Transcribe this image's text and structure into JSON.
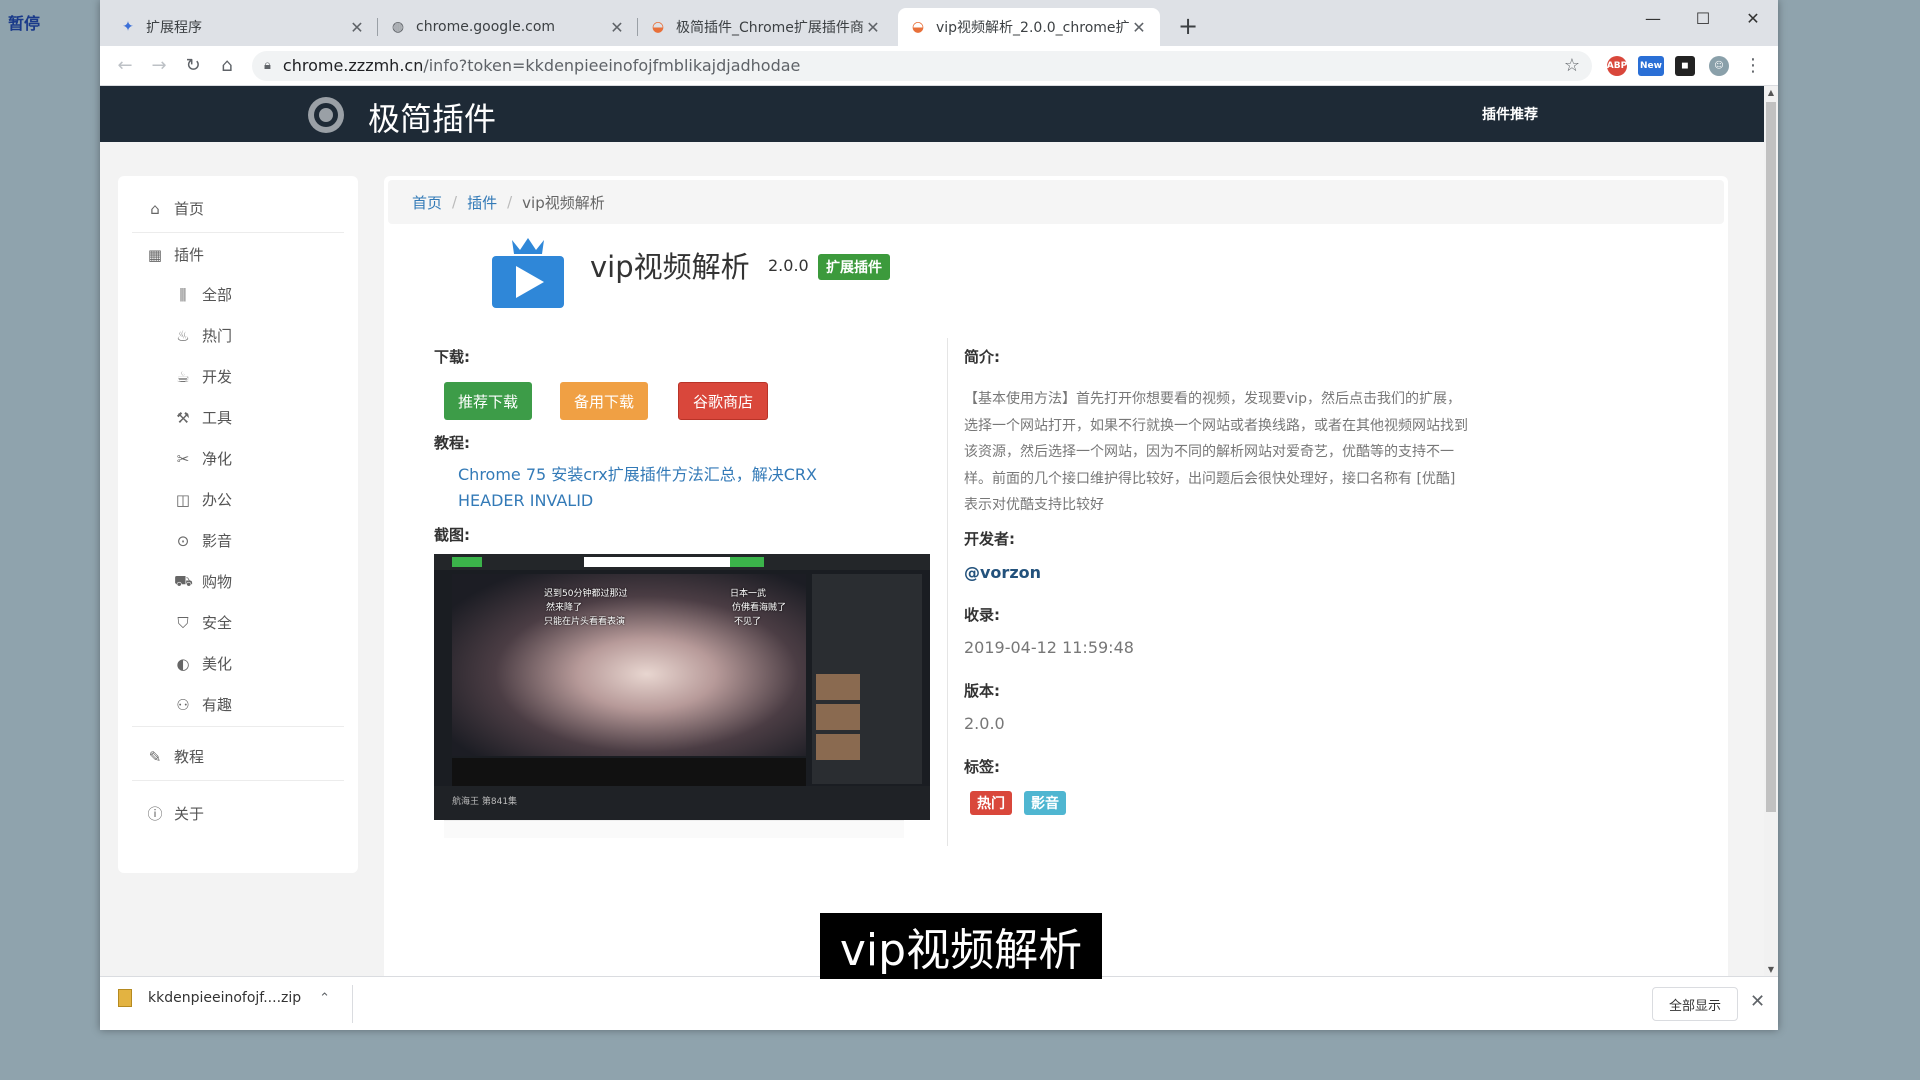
{
  "desktop": {
    "label": "暂停"
  },
  "browser": {
    "tabs": [
      {
        "title": "扩展程序",
        "icon": "puzzle-icon",
        "close": "✕"
      },
      {
        "title": "chrome.google.com",
        "icon": "globe-icon",
        "close": "✕"
      },
      {
        "title": "极简插件_Chrome扩展插件商店",
        "icon": "rainbow-icon",
        "close": "✕"
      },
      {
        "title": "vip视频解析_2.0.0_chrome扩展",
        "icon": "rainbow-icon",
        "close": "✕"
      }
    ],
    "new_tab": "+",
    "window_controls": {
      "minimize": "—",
      "maximize": "☐",
      "close": "✕"
    },
    "address": {
      "domain": "chrome.zzzmh.cn",
      "path": "/info?token=kkdenpieeinofojfmblikajdjadhodae"
    },
    "extensions": [
      {
        "name": "adblock-icon",
        "text": "ABP",
        "color": "#d9473b"
      },
      {
        "name": "new-badge-icon",
        "text": "New",
        "color": "#2a6fd6"
      },
      {
        "name": "mask-icon",
        "text": "◼",
        "color": "#222222"
      },
      {
        "name": "profile-icon",
        "text": "☺",
        "color": "#8aa0aa"
      }
    ]
  },
  "site": {
    "brand": "极简插件",
    "header_link": "插件推荐",
    "sidebar": {
      "home": "首页",
      "plugins": "插件",
      "categories": [
        "全部",
        "热门",
        "开发",
        "工具",
        "净化",
        "办公",
        "影音",
        "购物",
        "安全",
        "美化",
        "有趣"
      ],
      "tutorial": "教程",
      "about": "关于"
    },
    "breadcrumb": {
      "home": "首页",
      "plugins": "插件",
      "current": "vip视频解析",
      "separator": "/"
    },
    "app": {
      "title": "vip视频解析",
      "version": "2.0.0",
      "type_label": "扩展插件"
    },
    "download": {
      "label": "下载:",
      "recommended": "推荐下载",
      "backup": "备用下载",
      "store": "谷歌商店"
    },
    "tutorial": {
      "label": "教程:",
      "link": "Chrome 75 安装crx扩展插件方法汇总，解决CRX HEADER INVALID"
    },
    "screenshot": {
      "label": "截图:",
      "captions": [
        "迟到50分钟都过那过",
        "然来降了",
        "只能在片头看看表演",
        "日本一武",
        "仿佛看海贼了",
        "不见了"
      ],
      "footer": "航海王 第841集"
    },
    "intro": {
      "label": "简介:",
      "text": "【基本使用方法】首先打开你想要看的视频，发现要vip，然后点击我们的扩展，选择一个网站打开，如果不行就换一个网站或者换线路，或者在其他视频网站找到该资源，然后选择一个网站，因为不同的解析网站对爱奇艺，优酷等的支持不一样。前面的几个接口维护得比较好，出问题后会很快处理好，接口名称有 [优酷] 表示对优酷支持比较好"
    },
    "developer": {
      "label": "开发者:",
      "value": "@vorzon"
    },
    "indexed": {
      "label": "收录:",
      "value": "2019-04-12 11:59:48"
    },
    "version_info": {
      "label": "版本:",
      "value": "2.0.0"
    },
    "tags": {
      "label": "标签:",
      "items": [
        "热门",
        "影音"
      ]
    }
  },
  "downloads_bar": {
    "file": "kkdenpieeinofojf....zip",
    "show_all": "全部显示",
    "close": "✕"
  },
  "video_subtitle": "vip视频解析"
}
